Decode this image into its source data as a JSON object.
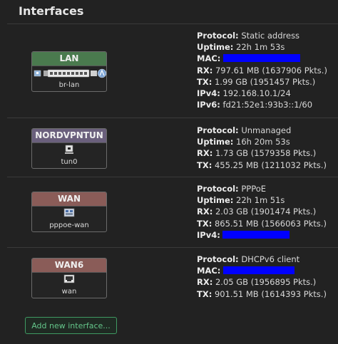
{
  "page": {
    "title": "Interfaces"
  },
  "interfaces": [
    {
      "name": "LAN",
      "device": "br-lan",
      "color": "#4a7a4e",
      "protocol_label": "Protocol:",
      "protocol": "Static address",
      "uptime_label": "Uptime:",
      "uptime": "22h 1m 53s",
      "mac_label": "MAC:",
      "rx_label": "RX:",
      "rx": "797.61 MB (1637906 Pkts.)",
      "tx_label": "TX:",
      "tx": "1.99 GB (1951457 Pkts.)",
      "ipv4_label": "IPv4:",
      "ipv4": "192.168.10.1/24",
      "ipv6_label": "IPv6:",
      "ipv6": "fd21:52e1:93b3::1/60",
      "icon": "switch-ports-icon"
    },
    {
      "name": "NORDVPNTUN",
      "device": "tun0",
      "color": "#6a5f7c",
      "protocol_label": "Protocol:",
      "protocol": "Unmanaged",
      "uptime_label": "Uptime:",
      "uptime": "16h 20m 53s",
      "rx_label": "RX:",
      "rx": "1.73 GB (1579358 Pkts.)",
      "tx_label": "TX:",
      "tx": "455.25 MB (1211032 Pkts.)",
      "icon": "tunnel-icon"
    },
    {
      "name": "WAN",
      "device": "pppoe-wan",
      "color": "#8a5c58",
      "protocol_label": "Protocol:",
      "protocol": "PPPoE",
      "uptime_label": "Uptime:",
      "uptime": "22h 1m 51s",
      "rx_label": "RX:",
      "rx": "2.03 GB (1901474 Pkts.)",
      "tx_label": "TX:",
      "tx": "865.51 MB (1566063 Pkts.)",
      "ipv4_label": "IPv4:",
      "icon": "pppoe-icon"
    },
    {
      "name": "WAN6",
      "device": "wan",
      "color": "#8a5c58",
      "protocol_label": "Protocol:",
      "protocol": "DHCPv6 client",
      "mac_label": "MAC:",
      "rx_label": "RX:",
      "rx": "2.05 GB (1956895 Pkts.)",
      "tx_label": "TX:",
      "tx": "901.51 MB (1614393 Pkts.)",
      "icon": "ethernet-port-icon"
    }
  ],
  "actions": {
    "add_label": "Add new interface..."
  },
  "colors": {
    "redaction": "#0000ff",
    "accent": "#64c58a"
  }
}
